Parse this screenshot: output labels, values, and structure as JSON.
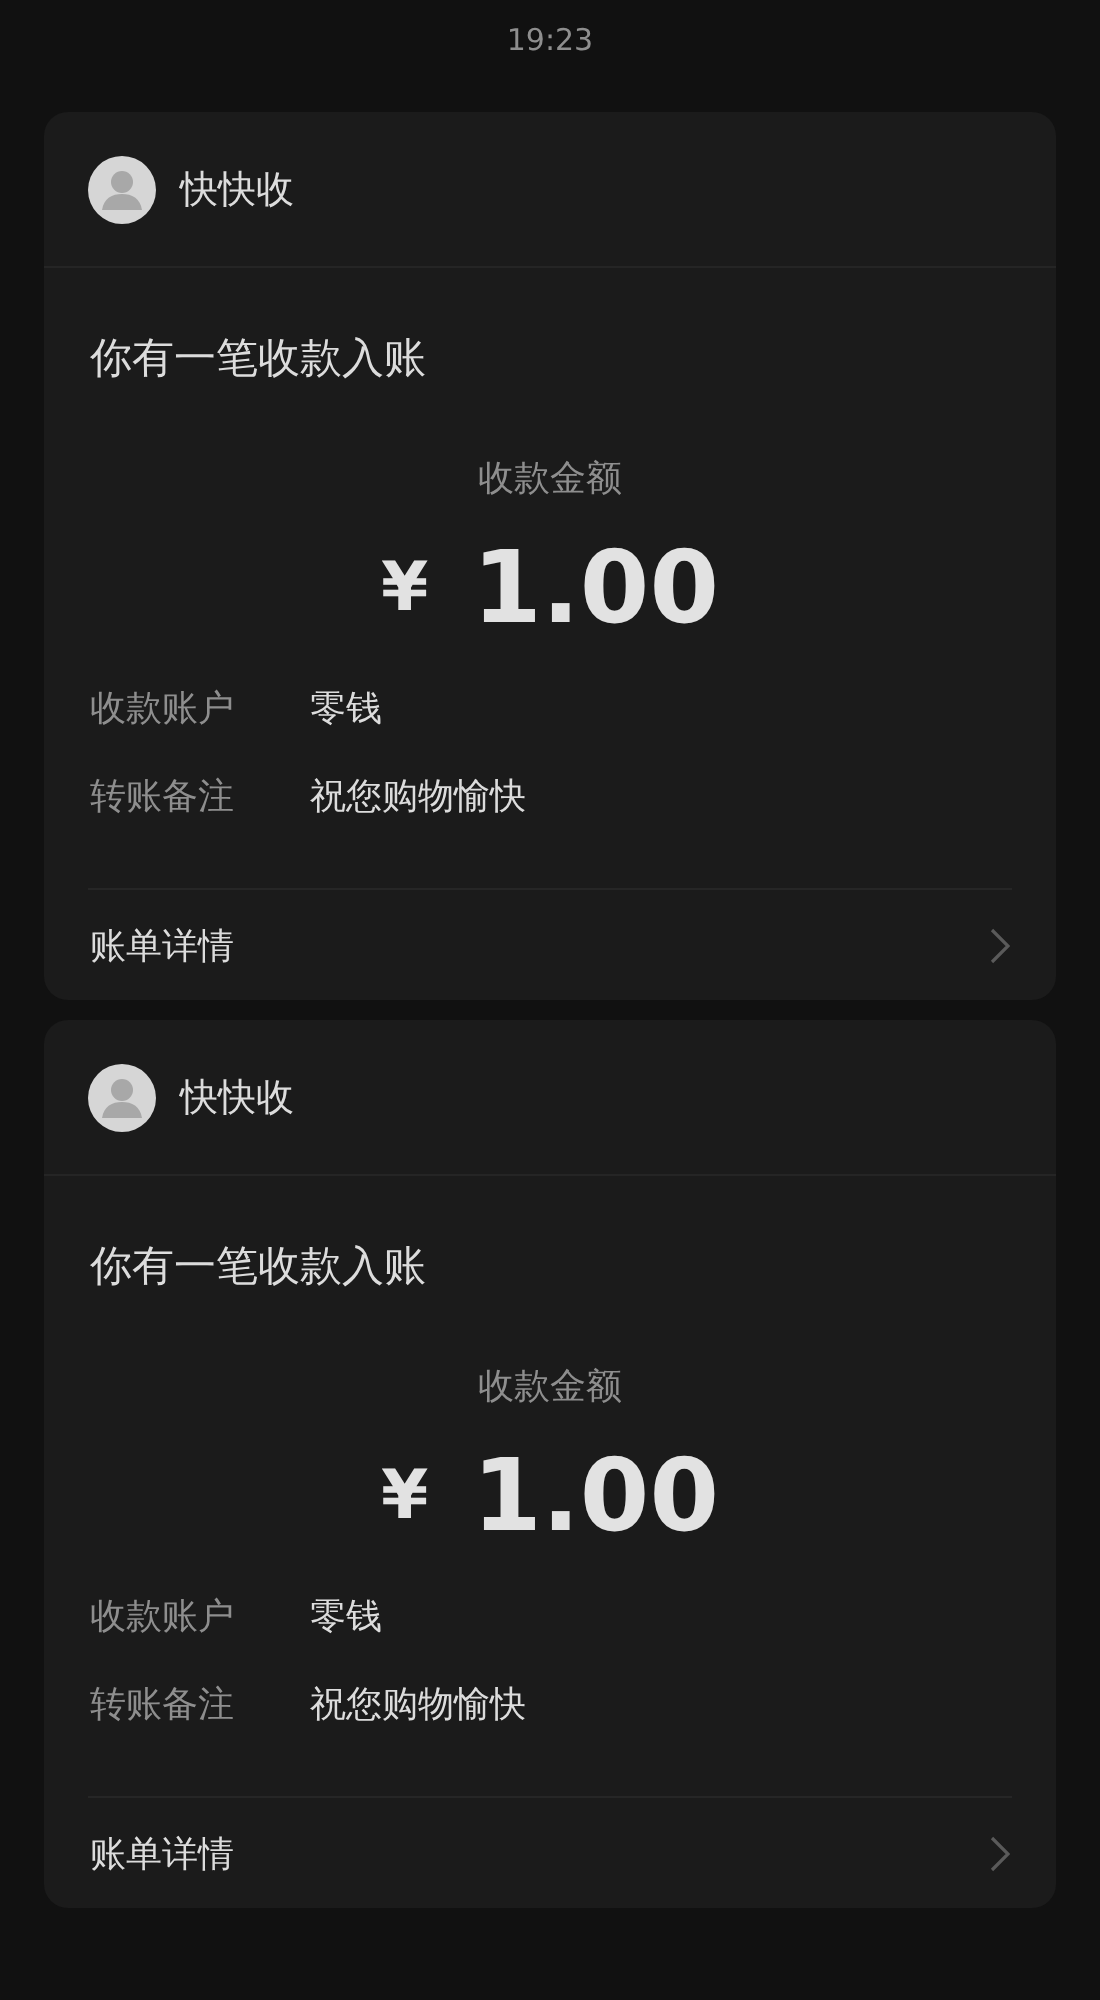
{
  "status_time": "19:23",
  "messages": [
    {
      "sender": "快快收",
      "title": "你有一笔收款入账",
      "amount_label": "收款金额",
      "currency": "¥",
      "amount": "1.00",
      "rows": [
        {
          "label": "收款账户",
          "value": "零钱"
        },
        {
          "label": "转账备注",
          "value": "祝您购物愉快"
        }
      ],
      "footer": "账单详情"
    },
    {
      "sender": "快快收",
      "title": "你有一笔收款入账",
      "amount_label": "收款金额",
      "currency": "¥",
      "amount": "1.00",
      "rows": [
        {
          "label": "收款账户",
          "value": "零钱"
        },
        {
          "label": "转账备注",
          "value": "祝您购物愉快"
        }
      ],
      "footer": "账单详情"
    }
  ]
}
